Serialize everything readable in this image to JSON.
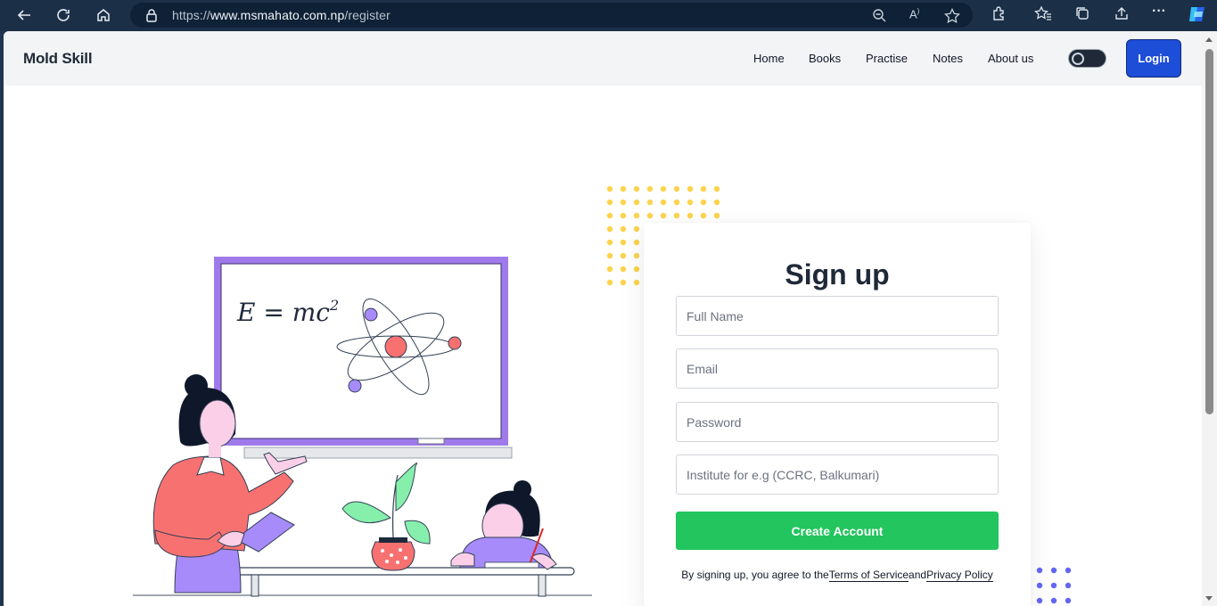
{
  "browser": {
    "url_scheme": "https://",
    "url_host": "www.msmahato.com.np",
    "url_path": "/register"
  },
  "site": {
    "brand": "Mold Skill",
    "nav": [
      "Home",
      "Books",
      "Practise",
      "Notes",
      "About us"
    ],
    "login_label": "Login"
  },
  "signup": {
    "title": "Sign up",
    "full_name_placeholder": "Full Name",
    "email_placeholder": "Email",
    "password_placeholder": "Password",
    "institute_placeholder": "Institute for e.g (CCRC, Balkumari)",
    "create_label": "Create Account",
    "terms_prefix": "By signing up, you agree to the",
    "terms_link": "Terms of Service",
    "terms_and": "and",
    "privacy_link": "Privacy Policy"
  },
  "illustration": {
    "board_formula": "E = mc",
    "board_formula_sup": "2"
  },
  "colors": {
    "login_button": "#1d4ed8",
    "create_button": "#22c55e",
    "accent_purple": "#9f7aea",
    "accent_red": "#f87171",
    "dots_yellow": "#fcd34d",
    "dots_blue": "#6366f1"
  }
}
